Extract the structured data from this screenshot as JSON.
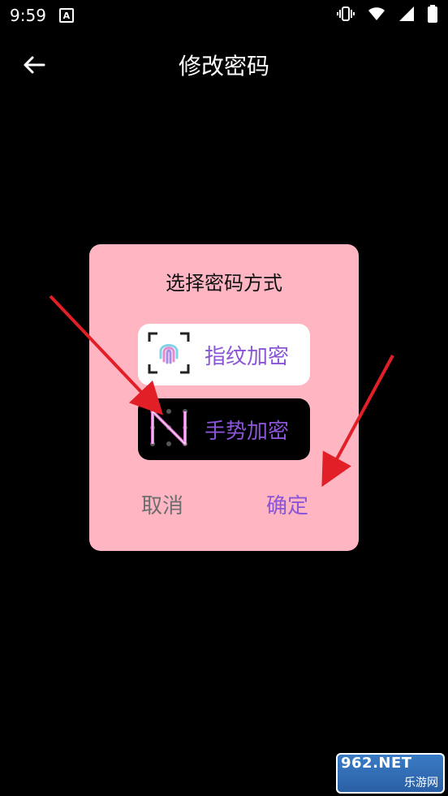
{
  "status": {
    "time": "9:59",
    "badge": "A"
  },
  "appbar": {
    "title": "修改密码"
  },
  "dialog": {
    "title": "选择密码方式",
    "options": [
      {
        "label": "指纹加密"
      },
      {
        "label": "手势加密"
      }
    ],
    "cancel_label": "取消",
    "ok_label": "确定"
  },
  "watermark": {
    "site": "962.NET",
    "name": "乐游网"
  },
  "colors": {
    "dialog_bg": "#FFB6C2",
    "accent_purple": "#8A55D6",
    "arrow_red": "#E21F26"
  }
}
